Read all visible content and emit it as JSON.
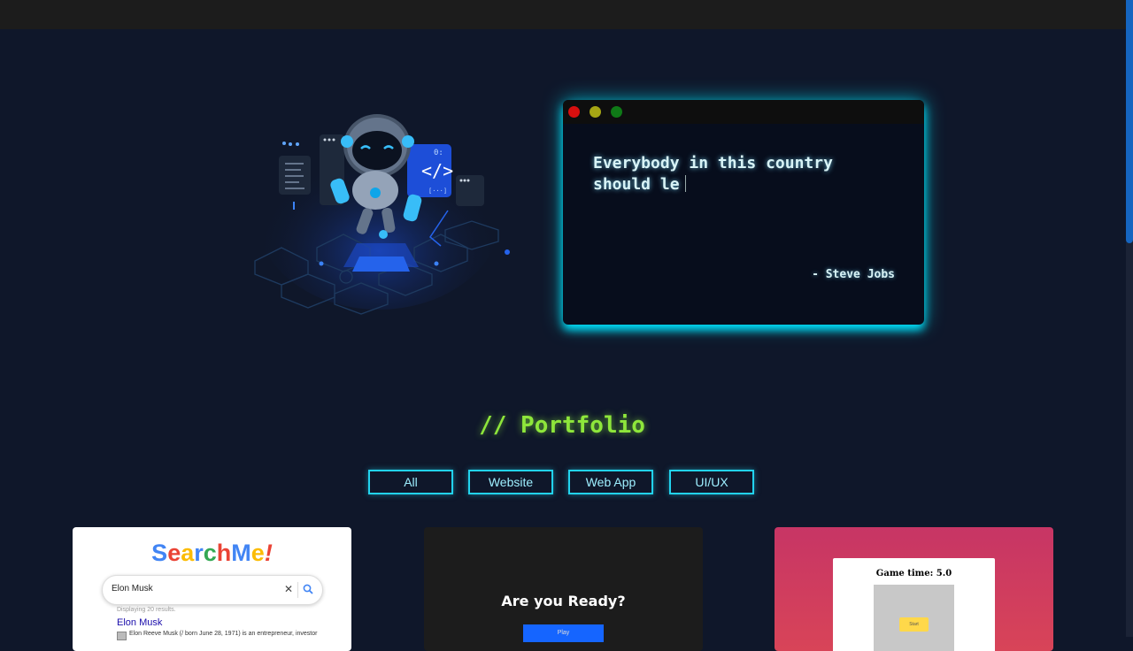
{
  "hero": {
    "typed_text": "Everybody in this country\nshould le",
    "author": "- Steve Jobs"
  },
  "portfolio": {
    "title": "// Portfolio",
    "filters": [
      "All",
      "Website",
      "Web App",
      "UI/UX"
    ]
  },
  "projects": {
    "searchme": {
      "logo_letters": [
        {
          "char": "S",
          "color": "#4285f4"
        },
        {
          "char": "e",
          "color": "#ea4335"
        },
        {
          "char": "a",
          "color": "#fbbc05"
        },
        {
          "char": "r",
          "color": "#4285f4"
        },
        {
          "char": "c",
          "color": "#34a853"
        },
        {
          "char": "h",
          "color": "#ea4335"
        },
        {
          "char": "M",
          "color": "#4285f4"
        },
        {
          "char": "e",
          "color": "#fbbc05"
        },
        {
          "char": "!",
          "color": "#ea4335"
        }
      ],
      "query": "Elon Musk",
      "result_count": "Displaying 20 results.",
      "result_title": "Elon Musk",
      "result_snippet": "Elon Reeve Musk (/ born June 28, 1971) is an entrepreneur, investor"
    },
    "ready_game": {
      "title": "Are you Ready?",
      "play_label": "Play"
    },
    "timer_game": {
      "game_time": "Game time: 5.0",
      "start_label": "Start"
    }
  },
  "colors": {
    "background": "#0f172a",
    "accent_cyan": "#22d3ee",
    "portfolio_green": "#8ee63b",
    "scroll_thumb": "#1565c0"
  }
}
